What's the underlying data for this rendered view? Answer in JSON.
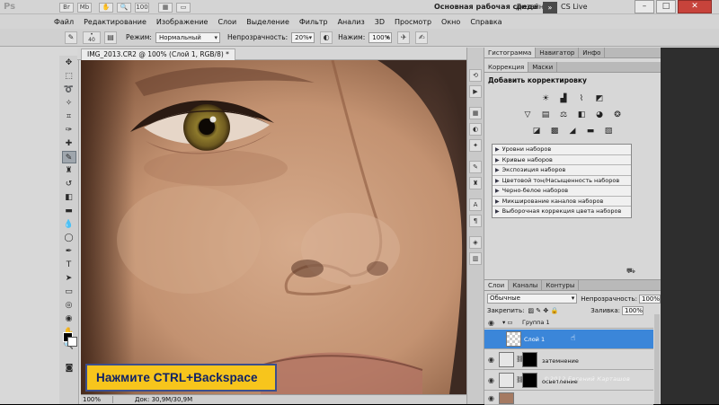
{
  "app": {
    "logo": "Ps",
    "workspace_active": "Основная рабочая среда",
    "workspace_other": "Дизайн",
    "more": "»",
    "cs_live": "CS Live",
    "win_min": "–",
    "win_max": "□",
    "win_close": "✕"
  },
  "menu": [
    "Файл",
    "Редактирование",
    "Изображение",
    "Слои",
    "Выделение",
    "Фильтр",
    "Анализ",
    "3D",
    "Просмотр",
    "Окно",
    "Справка"
  ],
  "options": {
    "brush_size": "40",
    "mode_label": "Режим:",
    "mode_value": "Нормальный",
    "opacity_label": "Непрозрачность:",
    "opacity_value": "20%",
    "pressure_label": "Нажим:",
    "pressure_value": "100%"
  },
  "document": {
    "tab_title": "IMG_2013.CR2 @ 100% (Слой 1, RGB/8) *",
    "zoom": "100%",
    "doc_info": "Док: 30,9M/30,9M"
  },
  "banner": {
    "text": "Нажмите CTRL+Backspace"
  },
  "panels": {
    "top_tabs": [
      "Гистограмма",
      "Навигатор",
      "Инфо"
    ],
    "adj_tabs": [
      "Коррекция",
      "Маски"
    ],
    "adj_title": "Добавить корректировку",
    "presets": [
      "Уровни наборов",
      "Кривые наборов",
      "Экспозиция наборов",
      "Цветовой тон/Насыщенность наборов",
      "Черно-белое наборов",
      "Микширование каналов наборов",
      "Выборочная коррекция цвета наборов"
    ]
  },
  "layers": {
    "tabs": [
      "Слои",
      "Каналы",
      "Контуры"
    ],
    "blend_mode": "Обычные",
    "opacity_label": "Непрозрачность:",
    "opacity_value": "100%",
    "lock_label": "Закрепить:",
    "fill_label": "Заливка:",
    "fill_value": "100%",
    "items": [
      {
        "name": "Группа 1"
      },
      {
        "name": "Слой 1"
      },
      {
        "name": "затемнение"
      },
      {
        "name": "осветление"
      }
    ]
  },
  "watermark": "©2012 Евгений Карташов"
}
